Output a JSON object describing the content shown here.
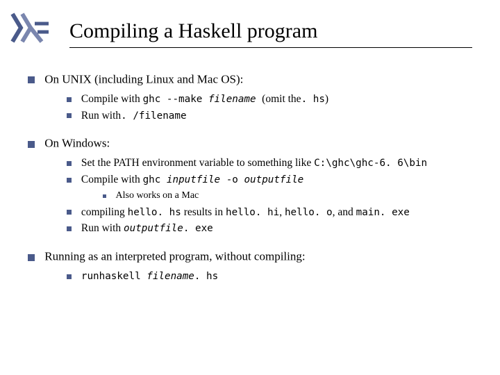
{
  "title": "Compiling a Haskell program",
  "logo": {
    "name": "haskell-logo"
  },
  "s1": {
    "heading": "On UNIX (including Linux and Mac OS):",
    "l1a": "Compile with ",
    "l1b": "ghc --make",
    "l1c": " filename ",
    "l1d": "  (omit the",
    "l1e": ". hs",
    "l1f": ")",
    "l2a": "Run with",
    "l2b": ". /filename"
  },
  "s2": {
    "heading": "On Windows:",
    "l1a": "Set the PATH environment variable to something like ",
    "l1b": "C:\\ghc\\ghc-6. 6\\bin",
    "l2a": "Compile with ",
    "l2b": "ghc ",
    "l2c": "inputfile",
    "l2d": " -o ",
    "l2e": "outputfile",
    "l3a": "Also works on a Mac",
    "l4a": "compiling ",
    "l4b": "hello. hs",
    "l4c": " results in ",
    "l4d": "hello. hi",
    "l4e": ", ",
    "l4f": "hello. o",
    "l4g": ", and ",
    "l4h": "main. exe",
    "l5a": "Run with ",
    "l5b": "outputfile",
    "l5c": ". exe"
  },
  "s3": {
    "heading": "Running as an interpreted program, without compiling:",
    "l1a": "runhaskell",
    "l1b": " filename",
    "l1c": ". hs"
  }
}
